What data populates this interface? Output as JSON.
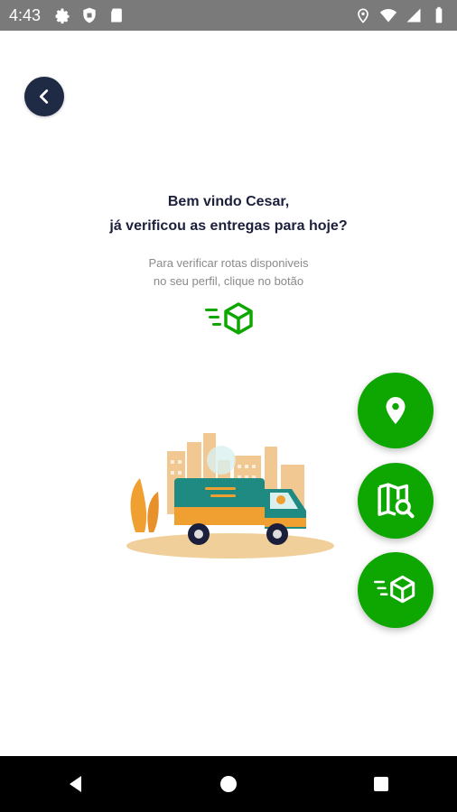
{
  "status": {
    "time": "4:43",
    "left_icons": [
      "gear-icon",
      "shield-icon",
      "sd-card-icon"
    ],
    "right_icons": [
      "location-pin-icon",
      "wifi-icon",
      "signal-icon",
      "battery-icon"
    ]
  },
  "header": {
    "back_icon": "chevron-left-icon"
  },
  "welcome": {
    "line1": "Bem vindo Cesar,",
    "line2": "já verificou as entregas para hoje?"
  },
  "helper": {
    "line1": "Para verificar rotas disponiveis",
    "line2": "no seu perfil, clique no botão"
  },
  "fabs": [
    {
      "name": "location",
      "icon": "location-pin-icon"
    },
    {
      "name": "map-search",
      "icon": "map-search-icon"
    },
    {
      "name": "delivery",
      "icon": "fast-delivery-box-icon"
    }
  ],
  "colors": {
    "primary": "#0ea600",
    "back_button": "#1f2a44",
    "title_text": "#1b1f3b",
    "helper_text": "#8a8a8a",
    "status_bar": "#7a7a7a"
  },
  "nav": {
    "buttons": [
      "back-triangle-icon",
      "home-circle-icon",
      "recents-square-icon"
    ]
  }
}
